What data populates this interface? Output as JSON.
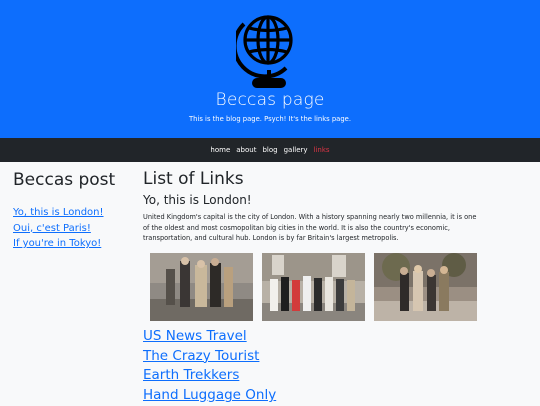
{
  "header": {
    "title": "Beccas page",
    "tagline": "This is the blog page. Psych! It's the links page.",
    "logo_icon": "globe-icon"
  },
  "nav": {
    "items": [
      {
        "label": "home"
      },
      {
        "label": "about"
      },
      {
        "label": "blog"
      },
      {
        "label": "gallery"
      },
      {
        "label": "links",
        "active": true
      }
    ],
    "active_color": "#dc3545"
  },
  "sidebar": {
    "title": "Beccas post",
    "links": [
      {
        "label": "Yo, this is London!"
      },
      {
        "label": "Oui, c'est Paris!"
      },
      {
        "label": "If you're in Tokyo!"
      }
    ]
  },
  "main": {
    "title": "List of Links",
    "subtitle": "Yo, this is London!",
    "body": "United Kingdom's capital is the city of London. With a history spanning nearly two millennia, it is one of the oldest and most cosmopolitan big cities in the world. It is also the country's economic, transportation, and cultural hub. London is by far Britain's largest metropolis.",
    "links": [
      {
        "label": "US News Travel"
      },
      {
        "label": "The Crazy Tourist"
      },
      {
        "label": "Earth Trekkers"
      },
      {
        "label": "Hand Luggage Only"
      }
    ]
  },
  "colors": {
    "hero_bg": "#0d6efd",
    "nav_bg": "#212529",
    "link": "#0d6efd"
  }
}
